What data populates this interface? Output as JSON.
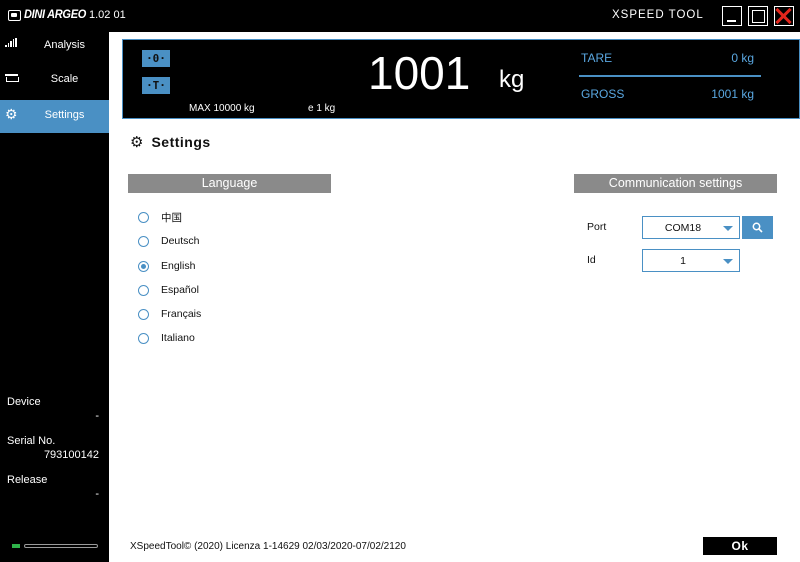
{
  "titlebar": {
    "brand": "DINI ARGEO",
    "version": "1.02 01",
    "app_name": "XSPEED TOOL"
  },
  "sidebar": {
    "items": [
      {
        "label": "Analysis",
        "icon": "signal-bars-icon",
        "active": false
      },
      {
        "label": "Scale",
        "icon": "scale-icon",
        "active": false
      },
      {
        "label": "Settings",
        "icon": "gear-icon",
        "active": true
      }
    ],
    "device_label": "Device",
    "device_value": "-",
    "serial_label": "Serial No.",
    "serial_value": "793100142",
    "release_label": "Release",
    "release_value": "-",
    "status_color": "#2fb34a"
  },
  "weight": {
    "zero_btn": "·0·",
    "tare_btn": "·T·",
    "value": "1001",
    "unit": "kg",
    "max_capacity": "MAX 10000 kg",
    "division": "e 1 kg",
    "tare_label": "TARE",
    "tare_value": "0 kg",
    "gross_label": "GROSS",
    "gross_value": "1001 kg"
  },
  "settings": {
    "title": "Settings",
    "language_header": "Language",
    "languages": [
      "中国",
      "Deutsch",
      "English",
      "Español",
      "Français",
      "Italiano"
    ],
    "selected_language": "English",
    "comm_header": "Communication settings",
    "port_label": "Port",
    "port_value": "COM18",
    "id_label": "Id",
    "id_value": "1"
  },
  "footer": {
    "license_text": "XSpeedTool© (2020)  Licenza 1-14629 02/03/2020-07/02/2120",
    "ok_label": "Ok"
  },
  "colors": {
    "accent": "#4a90c4",
    "background_dark": "#000000",
    "section_header": "#8a8a8a",
    "close_red": "#e3261c"
  }
}
